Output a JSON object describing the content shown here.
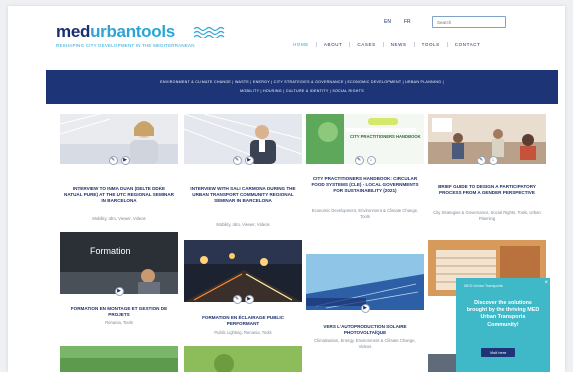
{
  "header": {
    "logo_dark": "med",
    "logo_light": "urbantools",
    "tagline": "Reshaping city development in the Mediterranean",
    "lang_1": "EN",
    "lang_2": "FR",
    "search_placeholder": "Search"
  },
  "nav": {
    "items": [
      "HOME",
      "ABOUT",
      "CASES",
      "NEWS",
      "TOOLS",
      "CONTACT"
    ]
  },
  "filters": {
    "row1": "ENVIRONMENT & CLIMATE CHANGE | WASTE | ENERGY | CITY STRATEGIES & GOVERNANCE | ECONOMIC DEVELOPMENT | URBAN PLANNING |",
    "row2": "MOBILITY | HOUSING | CULTURE & IDENTITY | SOCIAL RIGHTS"
  },
  "cards": [
    {
      "title": "INTERVIEW TO INMA DUAN (DELTE DDKE NATUAL PURE) AT THE UTC REGIONAL SEMINAR IN BARCELONA",
      "tags": "Mobility, Idro, Viewer, Videos"
    },
    {
      "title": "INTERVIEW WITH SALI CARMONA DURING THE URBAN TRANSPORT COMMUNITY REGIONAL SEMINAR IN BARCELONA",
      "tags": "Mobility, Idro, Viewer, Videos"
    },
    {
      "title": "CITY PRACTITIONERS HANDBOOK: CIRCULAR FOOD SYSTEMS (CLE) - LOCAL GOVERNMENTS FOR SUSTAINABILITY (2021)",
      "tags": "Economic Development, Environment & Climate Change, Tools"
    },
    {
      "title": "BRIEF GUIDE TO DESIGN A PARTICIPATORY PROCESS FROM A GENDER PERSPECTIVE",
      "tags": "City Strategies & Governance, Social Rights, Tools, Urban Planning"
    },
    {
      "title": "FORMATION EN MONTAGE ET GESTION DE PROJETS",
      "tags": "Renania, Tools"
    },
    {
      "title": "FORMATION EN ÉCLAIRAGE PUBLIC PERFORMANT",
      "tags": "Public Lighting, Renania, Tools"
    },
    {
      "title": "VERS L'AUTOPRODUCTION SOLAIRE PHOTOVOLTAÏQUE",
      "tags": "Climatisation, Energy, Environment & Climate Change, Videos"
    }
  ],
  "thumb_labels": {
    "formation": "Formation",
    "handbook": "CITY PRACTITIONERS HANDBOOK"
  },
  "popup": {
    "brand": "MED Urban Transports",
    "message": "Discover the solutions brought by the thriving MED Urban Transports Community!",
    "button": "Visit here",
    "close": "×"
  },
  "colors": {
    "navy": "#1d3577",
    "accent": "#2ea4d6",
    "popup": "#3fb8c8"
  }
}
